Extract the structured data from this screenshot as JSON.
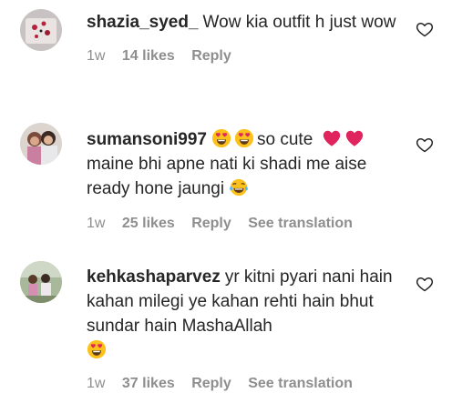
{
  "comments": [
    {
      "username": "shazia_syed_",
      "text": "Wow kia outfit h just wow",
      "time": "1w",
      "likes": "14 likes",
      "reply": "Reply",
      "avatar_icon": "avatar-icon"
    },
    {
      "username": "sumansoni997",
      "text_a": "so cute",
      "text_b": "maine bhi apne nati ki shadi me aise ready hone jaungi",
      "time": "1w",
      "likes": "25 likes",
      "reply": "Reply",
      "see_translation": "See translation",
      "avatar_icon": "avatar-icon"
    },
    {
      "username": "kehkashaparvez",
      "text": "yr kitni pyari nani hain kahan milegi ye kahan rehti hain bhut sundar hain MashaAllah",
      "time": "1w",
      "likes": "37 likes",
      "reply": "Reply",
      "see_translation": "See translation",
      "avatar_icon": "avatar-icon"
    }
  ],
  "icons": {
    "like": "heart-outline-icon",
    "heart_eyes": "heart-eyes-emoji",
    "red_heart": "red-heart-emoji",
    "tears_of_joy": "tears-of-joy-emoji"
  },
  "colors": {
    "text": "#262626",
    "meta": "#8e8e8e",
    "heart_red": "#e0245e"
  }
}
